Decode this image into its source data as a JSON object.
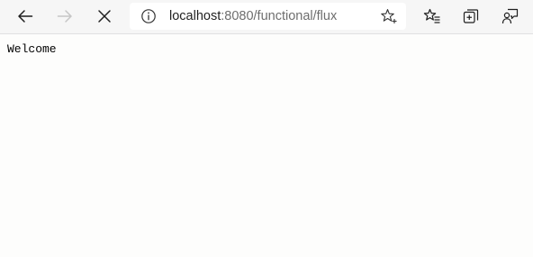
{
  "browser": {
    "url": {
      "host": "localhost",
      "rest": ":8080/functional/flux"
    },
    "icons": {
      "back": "back-arrow-icon",
      "forward": "forward-arrow-icon",
      "stop": "stop-loading-icon",
      "info": "site-info-icon",
      "favorite": "add-favorite-star-icon",
      "favorites": "favorites-icon",
      "collections": "collections-icon",
      "share": "feedback-icon"
    },
    "colors": {
      "toolbar_bg": "#f6f6f6",
      "address_bg": "#ffffff",
      "icon_active": "#1f1f1f",
      "icon_disabled": "#c6c6c6"
    }
  },
  "page": {
    "body_text": "Welcome",
    "background": "#fdfdfc"
  }
}
